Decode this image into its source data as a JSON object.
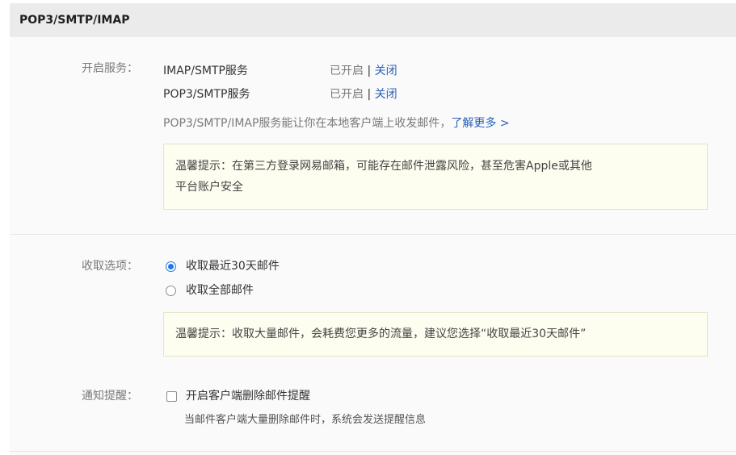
{
  "header": {
    "title": "POP3/SMTP/IMAP"
  },
  "services": {
    "label": "开启服务：",
    "items": [
      {
        "name": "IMAP/SMTP服务",
        "status": "已开启",
        "separator": "|",
        "action": "关闭"
      },
      {
        "name": "POP3/SMTP服务",
        "status": "已开启",
        "separator": "|",
        "action": "关闭"
      }
    ],
    "description": "POP3/SMTP/IMAP服务能让你在本地客户端上收发邮件，",
    "learn_more": "了解更多 >",
    "tip_line1": "温馨提示：在第三方登录网易邮箱，可能存在邮件泄露风险，甚至危害Apple或其他",
    "tip_line2": "平台账户安全"
  },
  "receive": {
    "label": "收取选项：",
    "options": [
      {
        "label": "收取最近30天邮件",
        "selected": true
      },
      {
        "label": "收取全部邮件",
        "selected": false
      }
    ],
    "tip": "温馨提示：收取大量邮件，会耗费您更多的流量，建议您选择“收取最近30天邮件”"
  },
  "notify": {
    "label": "通知提醒：",
    "checkbox_label": "开启客户端删除邮件提醒",
    "checked": false,
    "note": "当邮件客户端大量删除邮件时，系统会发送提醒信息"
  },
  "colors": {
    "accent": "#1f7aea",
    "link": "#2a61b8",
    "tip_bg": "#fdfdf0",
    "header_bg": "#ebebeb"
  }
}
